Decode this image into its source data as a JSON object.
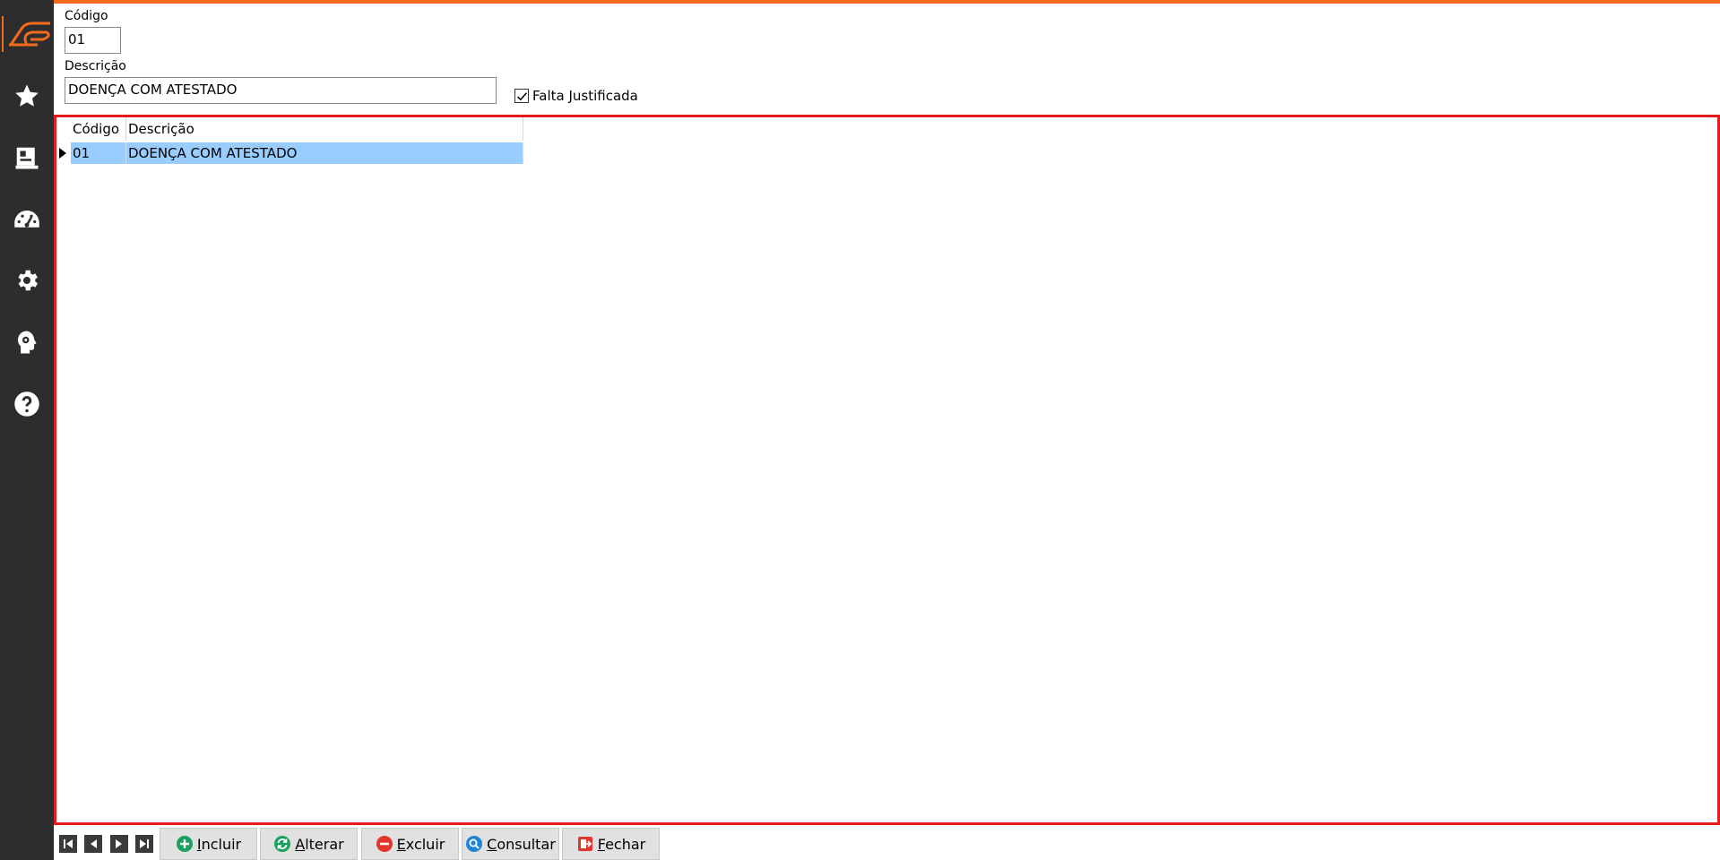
{
  "form": {
    "codigo_label": "Código",
    "codigo_value": "01",
    "descricao_label": "Descrição",
    "descricao_value": "DOENÇA COM ATESTADO",
    "falta_label": "Falta Justificada",
    "falta_checked": true
  },
  "grid": {
    "columns": [
      "Código",
      "Descrição"
    ],
    "rows": [
      {
        "codigo": "01",
        "descricao": "DOENÇA COM ATESTADO"
      }
    ]
  },
  "buttons": {
    "incluir_first": "I",
    "incluir_rest": "ncluir",
    "alterar_first": "A",
    "alterar_rest": "lterar",
    "excluir_first": "E",
    "excluir_rest": "xcluir",
    "consultar_first": "C",
    "consultar_rest": "onsultar",
    "fechar_first": "F",
    "fechar_rest": "echar"
  },
  "sidebar": {
    "icons": [
      "logo-icon",
      "star-icon",
      "report-icon",
      "dashboard-icon",
      "settings-icon",
      "support-icon",
      "help-icon"
    ]
  },
  "colors": {
    "accent": "#f26a1b",
    "sidebar": "#2d2d2d",
    "grid_border": "#e31c1c",
    "selected_row": "#99ccff"
  }
}
